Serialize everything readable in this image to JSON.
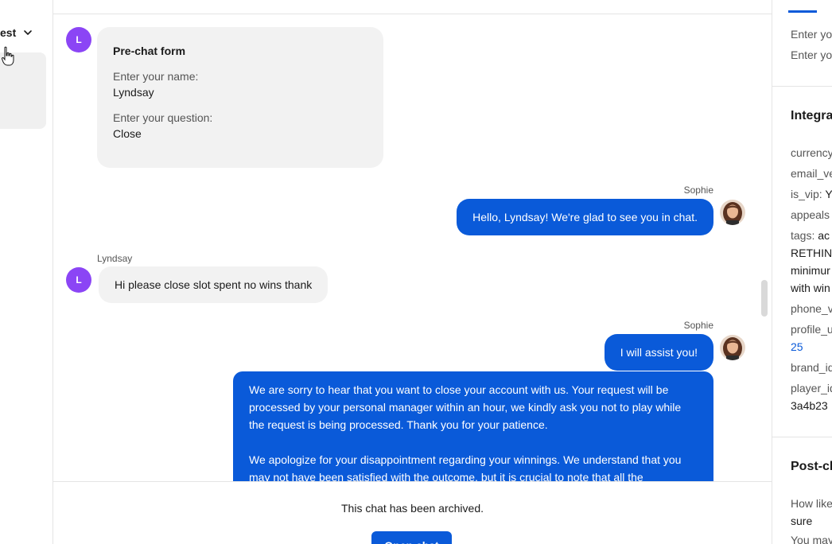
{
  "left": {
    "filter_label": "est",
    "chevron_icon": "chevron-down-icon"
  },
  "chat": {
    "form": {
      "title": "Pre-chat form",
      "fields": [
        {
          "question": "Enter your name:",
          "answer": "Lyndsay"
        },
        {
          "question": "Enter your question:",
          "answer": "Close"
        }
      ],
      "avatar_letter": "L"
    },
    "messages": [
      {
        "sender": "Sophie",
        "text": "Hello, Lyndsay! We're glad to see you in chat."
      },
      {
        "sender": "Lyndsay",
        "text": "Hi please close slot spent no wins thank",
        "avatar_letter": "L"
      },
      {
        "sender": "Sophie",
        "text": "I will assist you!"
      }
    ],
    "long_message": {
      "para1": "We are sorry to hear that you want to close your account with us. Your request will be processed by your personal manager within an hour, we kindly ask you not to play while the request is being processed. Thank you for your patience.",
      "para2": "We apologize for your disappointment regarding your winnings. We understand that you may not have been satisfied with the outcome, but it is crucial to note that all the"
    },
    "archive_text": "This chat has been archived.",
    "open_button": "Open chat"
  },
  "right": {
    "enter_1": "Enter yo",
    "enter_2": "Enter yo",
    "integrations_heading": "Integra",
    "fields": {
      "currency": "currency",
      "email_ve": "email_ve",
      "is_vip_label": "is_vip:",
      "is_vip_value": "Y",
      "appeals": "appeals",
      "tags_label": "tags:",
      "tags_value_1": "ac",
      "tags_value_2": "RETHIN",
      "tags_value_3": "minimur",
      "tags_value_4": "with win",
      "phone_v": "phone_v",
      "profile_u": "profile_u",
      "profile_u_value": "25",
      "brand_id": "brand_id",
      "player_id": "player_id",
      "player_id_value": "3a4b23"
    },
    "post_chat_heading": "Post-ch",
    "post_q1": "How like",
    "post_a1": "sure",
    "post_q2": "You may"
  }
}
